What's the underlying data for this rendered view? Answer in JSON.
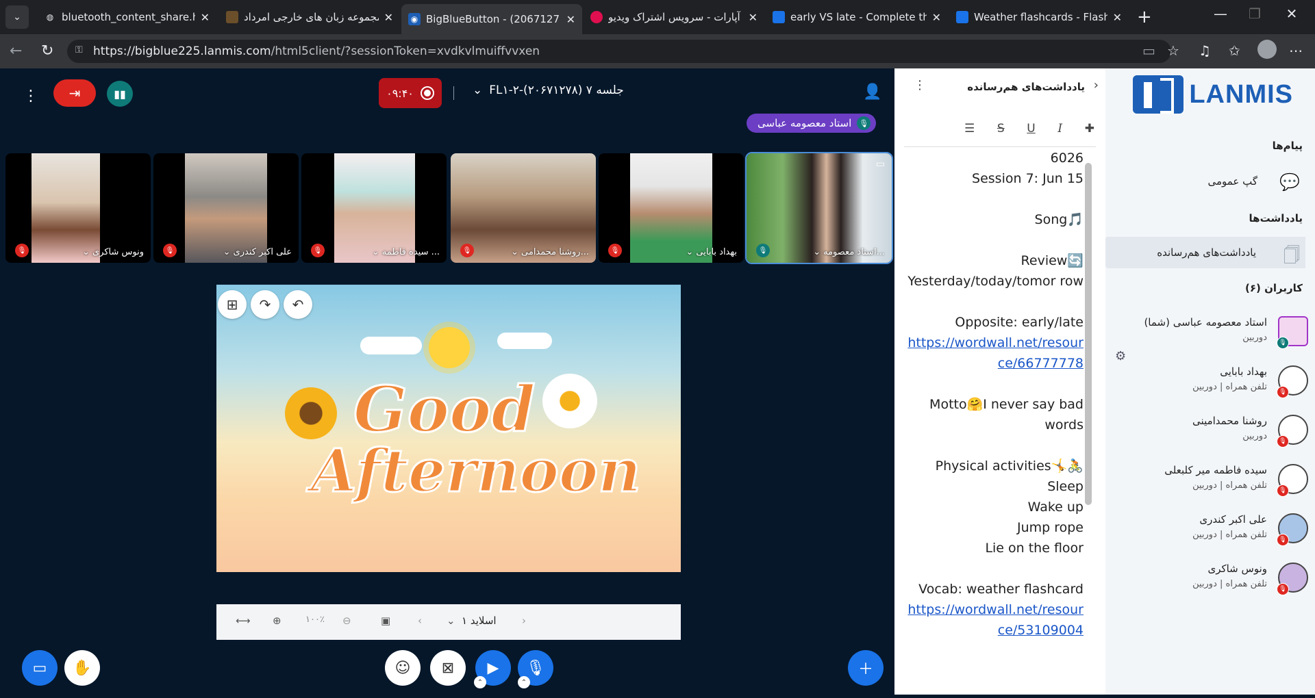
{
  "browser": {
    "tabs": [
      {
        "title": "bluetooth_content_share.html",
        "icon": "globe-icon",
        "color": "#5f6368"
      },
      {
        "title": "مجموعه زبان های خارجی امرداد",
        "icon": "site-icon",
        "color": "#6b4f2a"
      },
      {
        "title": "BigBlueButton - (2067127",
        "icon": "bbb-icon",
        "color": "#1d5fb6",
        "active": true
      },
      {
        "title": "آپارات - سرویس اشتراک ویدیو",
        "icon": "aparat-icon",
        "color": "#df0f50"
      },
      {
        "title": "early VS late - Complete the s",
        "icon": "wordwall-icon",
        "color": "#1a73e8"
      },
      {
        "title": "Weather flashcards - Flash car",
        "icon": "wordwall-icon",
        "color": "#1a73e8"
      }
    ],
    "url_host": "https://bigblue225.lanmis.com",
    "url_path": "/html5client/?sessionToken=xvdkvlmuiffvvxen"
  },
  "header": {
    "recording_time": "۰۹:۴۰",
    "meeting_title": "جلسه ۷ (۲۰۶۷۱۲۷۸)-FL۱-۲",
    "talking_indicator": "استاد معصومه عباسی"
  },
  "cameras": [
    {
      "name": "استاد معصومه...",
      "mic_on": true,
      "speaking": true
    },
    {
      "name": "بهداد بابایی",
      "mic_on": false
    },
    {
      "name": "روشنا محمدامی...",
      "mic_on": false
    },
    {
      "name": "سیده فاطمه ...",
      "mic_on": false
    },
    {
      "name": "علی اکبر کندری",
      "mic_on": false
    },
    {
      "name": "ونوس شاکری",
      "mic_on": false
    }
  ],
  "presentation": {
    "line1": "Good",
    "line2": "Afternoon",
    "slide_label": "اسلاید ۱",
    "zoom": "۱۰۰٪"
  },
  "notes": {
    "title": "یادداشت‌های هم‌رسانده",
    "lines": [
      {
        "t": "6026"
      },
      {
        "t": "Session 7: Jun 15"
      },
      {
        "t": ""
      },
      {
        "t": "🎵Song"
      },
      {
        "t": ""
      },
      {
        "t": "🔄Review"
      },
      {
        "t": "Yesterday/today/tomor row"
      },
      {
        "t": ""
      },
      {
        "t": "Opposite: early/late"
      },
      {
        "t": "https://wordwall.net/resource/66777778",
        "link": true
      },
      {
        "t": ""
      },
      {
        "t": "Motto🤗I never say bad words"
      },
      {
        "t": ""
      },
      {
        "t": "🚴🤸Physical activities"
      },
      {
        "t": "Sleep"
      },
      {
        "t": "Wake up"
      },
      {
        "t": "Jump rope"
      },
      {
        "t": "Lie on the floor"
      },
      {
        "t": ""
      },
      {
        "t": "Vocab: weather flashcard"
      },
      {
        "t": "https://wordwall.net/resource/53109004",
        "link": true
      }
    ]
  },
  "sidebar": {
    "messages_heading": "پیام‌ها",
    "public_chat": "گپ عمومی",
    "notes_heading": "یادداشت‌ها",
    "shared_notes": "یادداشت‌های هم‌رسانده",
    "users_heading": "کاربران (۶)",
    "users": [
      {
        "name": "استاد معصومه عباسی (شما)",
        "device": "دوربین",
        "me": true,
        "mic_on": true
      },
      {
        "name": "بهداد بابایی",
        "device": "تلفن همراه | دوربین",
        "mic_on": false
      },
      {
        "name": "روشنا محمدامینی",
        "device": "دوربین",
        "mic_on": false
      },
      {
        "name": "سیده فاطمه میر کلبعلی",
        "device": "تلفن همراه | دوربین",
        "mic_on": false
      },
      {
        "name": "علی اکبر کندری",
        "device": "تلفن همراه | دوربین",
        "mic_on": false
      },
      {
        "name": "ونوس شاکری",
        "device": "تلفن همراه | دوربین",
        "mic_on": false
      }
    ]
  }
}
